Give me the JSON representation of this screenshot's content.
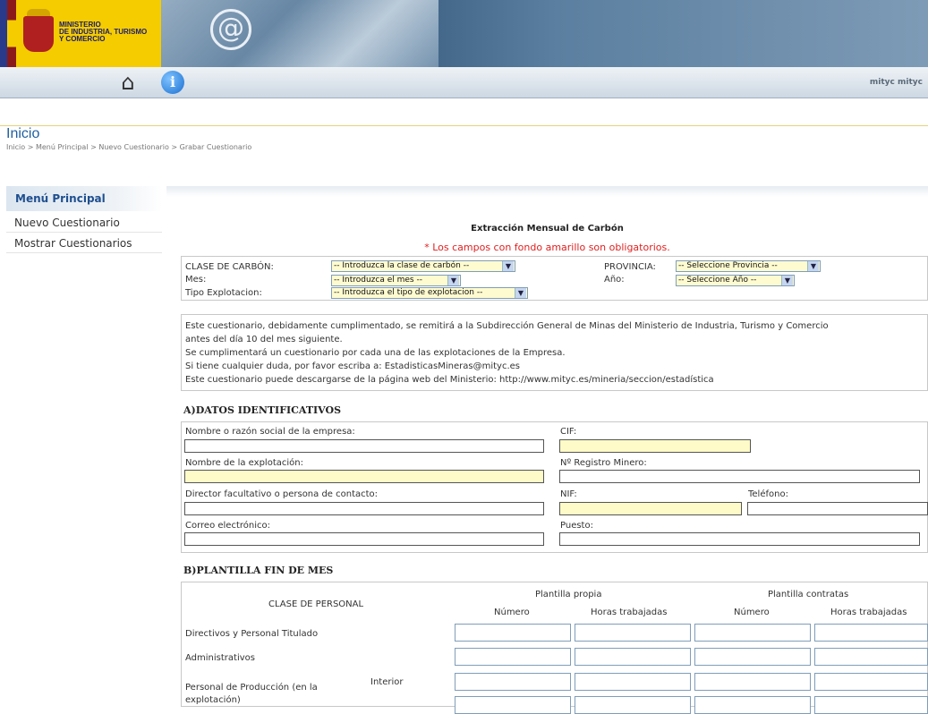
{
  "header": {
    "ministry_lines": [
      "MINISTERIO",
      "DE INDUSTRIA, TURISMO",
      "Y COMERCIO"
    ],
    "at_symbol": "@",
    "icons": [
      "home-icon",
      "info-icon"
    ],
    "info_glyph": "i",
    "user": "mityc mityc"
  },
  "page": {
    "title": "Inicio",
    "breadcrumb": "Inicio > Menú Principal > Nuevo Cuestionario > Grabar Cuestionario"
  },
  "sidebar": {
    "heading": "Menú Principal",
    "items": [
      "Nuevo Cuestionario",
      "Mostrar Cuestionarios"
    ]
  },
  "form": {
    "title": "Extracción Mensual de Carbón",
    "required_note": "* Los campos con fondo amarillo son obligatorios.",
    "top_fields": {
      "clase_label": "CLASE DE CARBÓN:",
      "clase_value": "-- Introduzca la clase de carbón --",
      "mes_label": "Mes:",
      "mes_value": "-- Introduzca el mes --",
      "tipo_label": "Tipo Explotacion:",
      "tipo_value": "-- Introduzca el tipo de explotacion --",
      "provincia_label": "PROVINCIA:",
      "provincia_value": "-- Seleccione Provincia --",
      "anio_label": "Año:",
      "anio_value": "-- Seleccione Año --"
    },
    "info_lines": [
      "Este cuestionario, debidamente cumplimentado, se remitirá a la Subdirección General de Minas del Ministerio de Industria, Turismo y Comercio",
      "antes del día 10 del mes siguiente.",
      "Se cumplimentará un cuestionario por cada una de las explotaciones de la Empresa.",
      "Si tiene cualquier duda, por favor escriba a: EstadisticasMineras@mityc.es",
      "Este cuestionario puede descargarse de la página web del Ministerio: http://www.mityc.es/mineria/seccion/estadística"
    ],
    "section_a": {
      "title": "A)DATOS IDENTIFICATIVOS",
      "nombre_empresa": "Nombre o razón social de la empresa:",
      "cif": "CIF:",
      "nombre_explotacion": "Nombre de la explotación:",
      "registro": "Nº Registro Minero:",
      "director": "Director facultativo o persona de contacto:",
      "nif": "NIF:",
      "telefono": "Teléfono:",
      "correo": "Correo electrónico:",
      "puesto": "Puesto:"
    },
    "section_b": {
      "title": "B)PLANTILLA FIN DE MES",
      "col_personal": "CLASE DE PERSONAL",
      "group_propia": "Plantilla propia",
      "group_contratas": "Plantilla contratas",
      "numero": "Número",
      "horas": "Horas trabajadas",
      "rows": [
        "Directivos y Personal Titulado",
        "Administrativos",
        "Personal de Producción (en la",
        "explotación)"
      ],
      "interior": "Interior"
    }
  }
}
